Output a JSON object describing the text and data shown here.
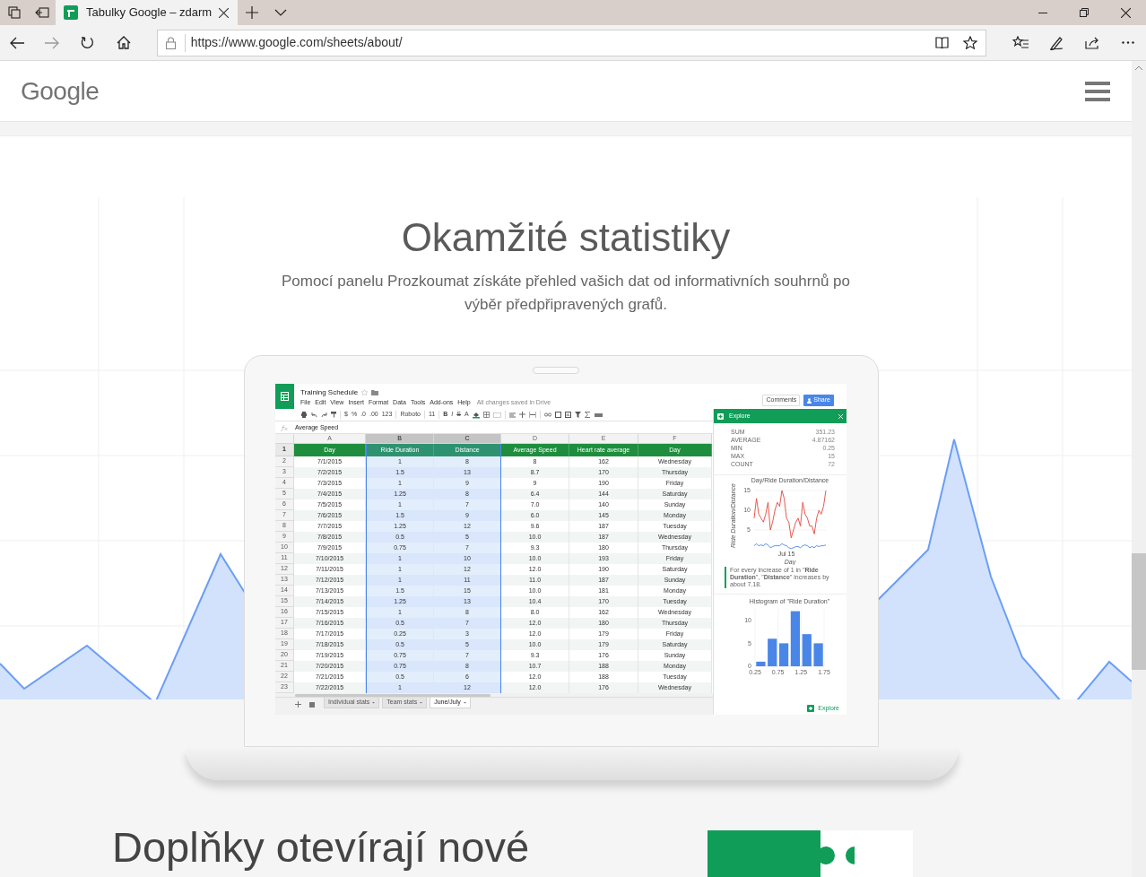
{
  "browser": {
    "tabs": [
      {
        "title": "Tabulky Google – zdarm",
        "selected": true
      }
    ],
    "address": "https://www.google.com/sheets/about/"
  },
  "site_header": {
    "logo": "Google"
  },
  "hero": {
    "title": "Okamžité statistiky",
    "description": "Pomocí panelu Prozkoumat získáte přehled vašich dat od informativních souhrnů po výběr předpřipravených grafů."
  },
  "spreadsheet": {
    "title": "Training Schedule",
    "menu": [
      "File",
      "Edit",
      "View",
      "Insert",
      "Format",
      "Data",
      "Tools",
      "Add-ons",
      "Help"
    ],
    "save_status": "All changes saved in Drive",
    "buttons": [
      {
        "label": "Comments",
        "kind": "plain"
      },
      {
        "label": "Share",
        "kind": "primary"
      }
    ],
    "toolbar": {
      "number_formats": [
        "$",
        "%",
        ".0",
        ".00",
        "123"
      ],
      "font": "Roboto",
      "font_size": "11",
      "text_styles": [
        "B",
        "I",
        "S",
        "A"
      ]
    },
    "formula": "Average Speed",
    "header_row_number": "1",
    "columns": [
      {
        "letter": "A",
        "header": "Day",
        "selected": false
      },
      {
        "letter": "B",
        "header": "Ride Duration",
        "selected": true
      },
      {
        "letter": "C",
        "header": "Distance",
        "selected": true
      },
      {
        "letter": "D",
        "header": "Average Speed",
        "selected": false
      },
      {
        "letter": "E",
        "header": "Heart rate average",
        "selected": false
      },
      {
        "letter": "F",
        "header": "Day",
        "selected": false
      }
    ],
    "rows": [
      {
        "number": "2",
        "cells": [
          "7/1/2015",
          "1",
          "8",
          "8",
          "162",
          "Wednesday"
        ]
      },
      {
        "number": "3",
        "cells": [
          "7/2/2015",
          "1.5",
          "13",
          "8.7",
          "170",
          "Thursday"
        ]
      },
      {
        "number": "4",
        "cells": [
          "7/3/2015",
          "1",
          "9",
          "9",
          "190",
          "Friday"
        ]
      },
      {
        "number": "5",
        "cells": [
          "7/4/2015",
          "1.25",
          "8",
          "6.4",
          "144",
          "Saturday"
        ]
      },
      {
        "number": "6",
        "cells": [
          "7/5/2015",
          "1",
          "7",
          "7.0",
          "140",
          "Sunday"
        ]
      },
      {
        "number": "7",
        "cells": [
          "7/6/2015",
          "1.5",
          "9",
          "6.0",
          "145",
          "Monday"
        ]
      },
      {
        "number": "8",
        "cells": [
          "7/7/2015",
          "1.25",
          "12",
          "9.6",
          "187",
          "Tuesday"
        ]
      },
      {
        "number": "9",
        "cells": [
          "7/8/2015",
          "0.5",
          "5",
          "10.0",
          "187",
          "Wednesday"
        ]
      },
      {
        "number": "10",
        "cells": [
          "7/9/2015",
          "0.75",
          "7",
          "9.3",
          "180",
          "Thursday"
        ]
      },
      {
        "number": "11",
        "cells": [
          "7/10/2015",
          "1",
          "10",
          "10.0",
          "193",
          "Friday"
        ]
      },
      {
        "number": "12",
        "cells": [
          "7/11/2015",
          "1",
          "12",
          "12.0",
          "190",
          "Saturday"
        ]
      },
      {
        "number": "13",
        "cells": [
          "7/12/2015",
          "1",
          "11",
          "11.0",
          "187",
          "Sunday"
        ]
      },
      {
        "number": "14",
        "cells": [
          "7/13/2015",
          "1.5",
          "15",
          "10.0",
          "181",
          "Monday"
        ]
      },
      {
        "number": "15",
        "cells": [
          "7/14/2015",
          "1.25",
          "13",
          "10.4",
          "170",
          "Tuesday"
        ]
      },
      {
        "number": "16",
        "cells": [
          "7/15/2015",
          "1",
          "8",
          "8.0",
          "162",
          "Wednesday"
        ]
      },
      {
        "number": "17",
        "cells": [
          "7/16/2015",
          "0.5",
          "7",
          "12.0",
          "180",
          "Thursday"
        ]
      },
      {
        "number": "18",
        "cells": [
          "7/17/2015",
          "0.25",
          "3",
          "12.0",
          "179",
          "Friday"
        ]
      },
      {
        "number": "19",
        "cells": [
          "7/18/2015",
          "0.5",
          "5",
          "10.0",
          "179",
          "Saturday"
        ]
      },
      {
        "number": "20",
        "cells": [
          "7/19/2015",
          "0.75",
          "7",
          "9.3",
          "176",
          "Sunday"
        ]
      },
      {
        "number": "21",
        "cells": [
          "7/20/2015",
          "0.75",
          "8",
          "10.7",
          "188",
          "Monday"
        ]
      },
      {
        "number": "22",
        "cells": [
          "7/21/2015",
          "0.5",
          "6",
          "12.0",
          "188",
          "Tuesday"
        ]
      },
      {
        "number": "23",
        "cells": [
          "7/22/2015",
          "1",
          "12",
          "12.0",
          "176",
          "Wednesday"
        ]
      }
    ],
    "sheet_tabs": [
      {
        "label": "Individual stats",
        "selected": false
      },
      {
        "label": "Team stats",
        "selected": false
      },
      {
        "label": "June/July",
        "selected": true
      }
    ]
  },
  "explore": {
    "title": "Explore",
    "stats": [
      {
        "label": "SUM",
        "value": "351.23"
      },
      {
        "label": "AVERAGE",
        "value": "4.87162"
      },
      {
        "label": "MIN",
        "value": "0.25"
      },
      {
        "label": "MAX",
        "value": "15"
      },
      {
        "label": "COUNT",
        "value": "72"
      }
    ],
    "line_chart": {
      "title": "Day/Ride Duration/Distance",
      "y_axis_title": "Ride Duration/Distance",
      "y_tick_labels": [
        "15",
        "10",
        "5"
      ],
      "x_tick_label": "Jul 15",
      "x_axis_title": "Day"
    },
    "insight": "For every increase of 1 in \"**Ride Duration**\", \"**Distance**\" increases by about 7.18.",
    "histogram": {
      "chart_data": {
        "type": "bar",
        "title": "Histogram of \"Ride Duration\"",
        "x": [
          0.375,
          0.625,
          0.875,
          1.125,
          1.375,
          1.625
        ],
        "values": [
          1,
          6,
          5,
          12,
          7,
          5
        ],
        "xlim": [
          0.25,
          1.75
        ],
        "ylim": [
          0,
          12.5
        ],
        "grid": true,
        "xticks": [
          0.25,
          0.75,
          1.25,
          1.75
        ],
        "yticks": [
          0,
          5,
          10
        ]
      }
    },
    "button": "Explore"
  },
  "next_section": {
    "title": "Doplňky otevírají nové"
  }
}
